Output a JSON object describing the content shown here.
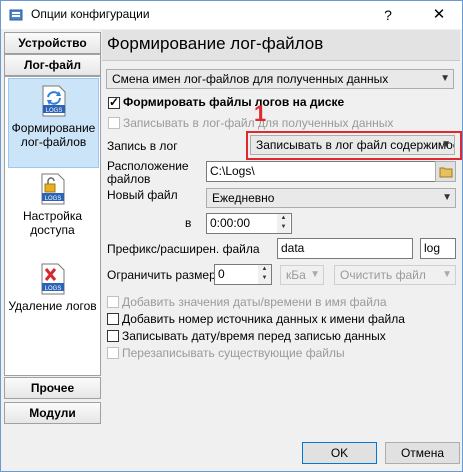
{
  "window": {
    "title": "Опции конфигурации",
    "help": "?",
    "close": "✕"
  },
  "sidebar": {
    "top_buttons": [
      "Устройство",
      "Лог-файл"
    ],
    "items": [
      {
        "label": "Формирование лог-файлов",
        "icon": "logs-refresh-icon"
      },
      {
        "label": "Настройка доступа",
        "icon": "logs-lock-icon"
      },
      {
        "label": "Удаление логов",
        "icon": "logs-delete-icon"
      }
    ],
    "bottom_buttons": [
      "Прочее",
      "Модули"
    ]
  },
  "main": {
    "title": "Формирование лог-файлов",
    "mode_combo": "Смена имен лог-файлов для полученных данных",
    "form_logs_checkbox": "Формировать файлы логов на диске",
    "write_received_checkbox": "Записывать в лог-файл для полученных данных",
    "annotation_number": "1",
    "write_to_log_label": "Запись в лог",
    "write_to_log_value": "Записывать в лог файл содержимое",
    "location_label": "Расположение файлов",
    "location_value": "C:\\Logs\\",
    "new_file_label": "Новый файл",
    "new_file_value": "Ежедневно",
    "at_label": "в",
    "time_value": "0:00:00",
    "prefix_label": "Префикс/расширен. файла",
    "prefix_value": "data",
    "ext_value": "log",
    "limit_label": "Ограничить размер",
    "limit_value": "0",
    "unit_value": "кБа",
    "clear_value": "Очистить файл",
    "options": [
      {
        "label": "Добавить значения даты/времени в имя файла",
        "checked": false,
        "enabled": false
      },
      {
        "label": "Добавить номер источника данных к имени файла",
        "checked": false,
        "enabled": true
      },
      {
        "label": "Записывать дату/время перед записью данных",
        "checked": false,
        "enabled": true
      },
      {
        "label": "Перезаписывать существующие файлы",
        "checked": false,
        "enabled": false
      }
    ]
  },
  "footer": {
    "ok": "OK",
    "cancel": "Отмена"
  },
  "colors": {
    "highlight": "#e0282f",
    "accent": "#0078d7",
    "selection": "#cce4f7"
  }
}
